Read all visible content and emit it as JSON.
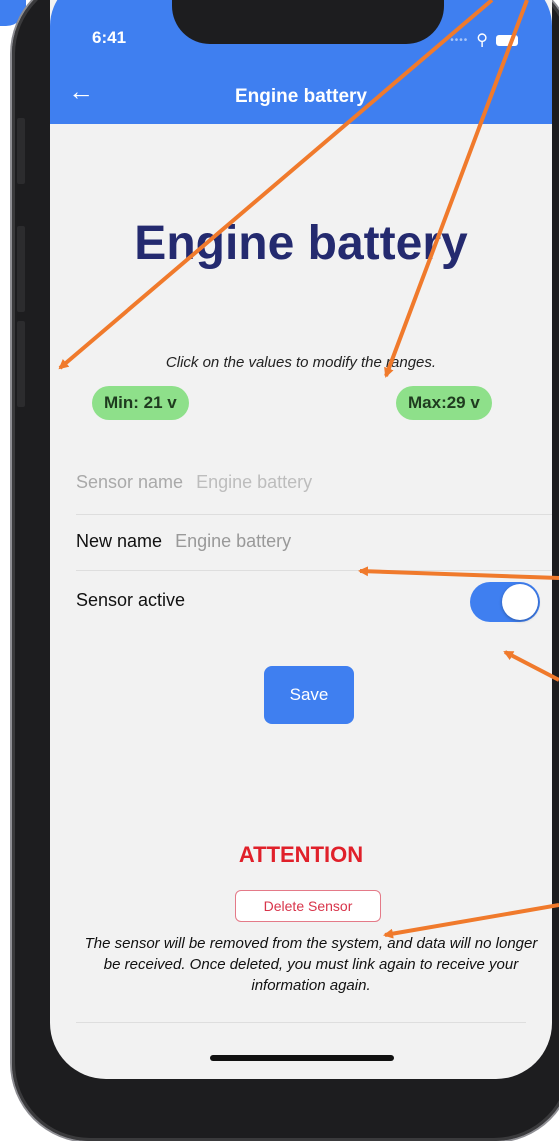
{
  "status_bar": {
    "time": "6:41"
  },
  "nav": {
    "title": "Engine battery"
  },
  "page": {
    "title": "Engine battery",
    "hint": "Click on the values to modify the ranges."
  },
  "ranges": {
    "min": "Min: 21 v",
    "max": "Max:29 v"
  },
  "form": {
    "sensor_name_label": "Sensor name",
    "sensor_name_value": "Engine battery",
    "new_name_label": "New name",
    "new_name_placeholder": "Engine battery",
    "sensor_active_label": "Sensor active",
    "sensor_active": true,
    "save_label": "Save"
  },
  "danger": {
    "heading": "ATTENTION",
    "delete_label": "Delete Sensor",
    "warning": "The sensor will be removed from the system, and data will no longer be received. Once deleted, you must link again to receive your information again."
  },
  "colors": {
    "accent": "#3f7ff0",
    "title": "#242a6f",
    "pill": "#8ee08a",
    "danger": "#e0202a",
    "annotation_arrow": "#f07a2c"
  },
  "icons": [
    "back-arrow-icon",
    "wifi-icon",
    "battery-icon",
    "signal-icon"
  ]
}
